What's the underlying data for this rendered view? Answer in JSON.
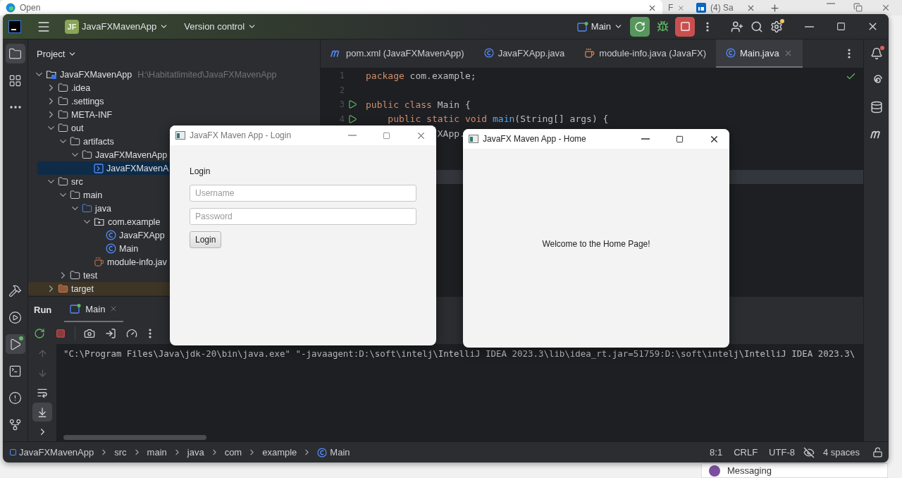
{
  "browser": {
    "tabs": [
      {
        "label": "Open",
        "kind": "edge",
        "selected": true
      },
      {
        "label": "F",
        "kind": "plain",
        "selected": false
      },
      {
        "label": "(4) Sa",
        "kind": "linkedin",
        "selected": false
      }
    ],
    "messaging": "Messaging"
  },
  "title_bar": {
    "project_badge": "JF",
    "project": "JavaFXMavenApp",
    "vcs": "Version control",
    "run_config": "Main"
  },
  "left_toolbar": {
    "top": [
      {
        "kind": "project",
        "selected": true
      },
      {
        "kind": "structure",
        "selected": false
      },
      {
        "kind": "more",
        "selected": false
      }
    ],
    "bottom": [
      {
        "kind": "build",
        "selected": false
      },
      {
        "kind": "services",
        "selected": false
      },
      {
        "kind": "run",
        "selected": true
      },
      {
        "kind": "terminal",
        "selected": false
      },
      {
        "kind": "problems",
        "selected": false
      },
      {
        "kind": "git",
        "selected": false
      }
    ]
  },
  "project_panel": {
    "title": "Project",
    "tree": [
      {
        "label": "JavaFXMavenApp",
        "hint": "H:\\Habitatlimited\\JavaFXMavenApp",
        "kind": "module",
        "expanded": true,
        "selected": false,
        "children": [
          {
            "label": ".idea",
            "kind": "folder",
            "expanded": false,
            "selected": false
          },
          {
            "label": ".settings",
            "kind": "folder",
            "expanded": false,
            "selected": false
          },
          {
            "label": "META-INF",
            "kind": "folder",
            "expanded": false,
            "selected": false
          },
          {
            "label": "out",
            "kind": "folder",
            "expanded": true,
            "selected": false,
            "children": [
              {
                "label": "artifacts",
                "kind": "folder",
                "expanded": true,
                "selected": false,
                "children": [
                  {
                    "label": "JavaFXMavenApp",
                    "kind": "folder",
                    "expanded": true,
                    "selected": false,
                    "children": [
                      {
                        "label": "JavaFXMavenA",
                        "kind": "artifact",
                        "selected": true
                      }
                    ]
                  }
                ]
              }
            ]
          },
          {
            "label": "src",
            "kind": "folder",
            "expanded": true,
            "selected": false,
            "children": [
              {
                "label": "main",
                "kind": "folder",
                "expanded": true,
                "selected": false,
                "children": [
                  {
                    "label": "java",
                    "kind": "source",
                    "expanded": true,
                    "selected": false,
                    "children": [
                      {
                        "label": "com.example",
                        "kind": "package",
                        "expanded": true,
                        "selected": false,
                        "children": [
                          {
                            "label": "JavaFXApp",
                            "kind": "class",
                            "selected": false
                          },
                          {
                            "label": "Main",
                            "kind": "class",
                            "selected": false
                          }
                        ]
                      },
                      {
                        "label": "module-info.jav",
                        "kind": "module-info",
                        "selected": false
                      }
                    ]
                  }
                ]
              },
              {
                "label": "test",
                "kind": "folder",
                "expanded": false,
                "selected": false
              }
            ]
          },
          {
            "label": "target",
            "kind": "excluded",
            "expanded": false,
            "selected": false
          }
        ]
      }
    ]
  },
  "editor": {
    "tabs": [
      {
        "label": "pom.xml (JavaFXMavenApp)",
        "kind": "maven",
        "selected": false
      },
      {
        "label": "JavaFXApp.java",
        "kind": "class",
        "selected": false
      },
      {
        "label": "module-info.java (JavaFX)",
        "kind": "module-info",
        "selected": false
      },
      {
        "label": "Main.java",
        "kind": "class",
        "selected": true
      }
    ],
    "lines": [
      {
        "number": "1",
        "runnable": false,
        "current": false,
        "tokens": [
          {
            "text": "package",
            "kind": "keyword"
          },
          {
            "text": " com.example;",
            "kind": "plain"
          }
        ]
      },
      {
        "number": "2",
        "runnable": false,
        "current": false
      },
      {
        "number": "3",
        "runnable": true,
        "current": false,
        "tokens": [
          {
            "text": "public class",
            "kind": "keyword"
          },
          {
            "text": " Main {",
            "kind": "plain"
          }
        ]
      },
      {
        "number": "4",
        "runnable": true,
        "current": false,
        "tokens": [
          {
            "text": "    public static void ",
            "kind": "keyword"
          },
          {
            "text": "main",
            "kind": "method"
          },
          {
            "text": "(String[] args) {",
            "kind": "plain"
          }
        ]
      },
      {
        "runnable": false,
        "current": false,
        "tokens": [
          {
            "text": "XApp.",
            "kind": "plain"
          }
        ]
      },
      {
        "runnable": false,
        "current": false
      },
      {
        "runnable": false,
        "current": false
      },
      {
        "runnable": false,
        "current": true
      }
    ]
  },
  "run_panel": {
    "title": "Run",
    "tabs": [
      {
        "label": "Main",
        "selected": true
      }
    ],
    "console": [
      "\"C:\\Program Files\\Java\\jdk-20\\bin\\java.exe\" \"-javaagent:D:\\soft\\intelj\\IntelliJ IDEA 2023.3\\lib\\idea_rt.jar=51759:D:\\soft\\intelj\\IntelliJ IDEA 2023.3\\"
    ]
  },
  "status_bar": {
    "breadcrumbs": [
      {
        "label": "JavaFXMavenApp",
        "kind": "module"
      },
      {
        "label": "src",
        "kind": "plain"
      },
      {
        "label": "main",
        "kind": "plain"
      },
      {
        "label": "java",
        "kind": "plain"
      },
      {
        "label": "com",
        "kind": "plain"
      },
      {
        "label": "example",
        "kind": "plain"
      },
      {
        "label": "Main",
        "kind": "class"
      }
    ],
    "position": "8:1",
    "line_separator": "CRLF",
    "encoding": "UTF-8",
    "indent": "4 spaces"
  },
  "login_window": {
    "title": "JavaFX Maven App - Login",
    "heading": "Login",
    "fields": [
      {
        "placeholder": "Username"
      },
      {
        "placeholder": "Password"
      }
    ],
    "button": "Login"
  },
  "home_window": {
    "title": "JavaFX Maven App - Home",
    "message": "Welcome to the Home Page!"
  }
}
